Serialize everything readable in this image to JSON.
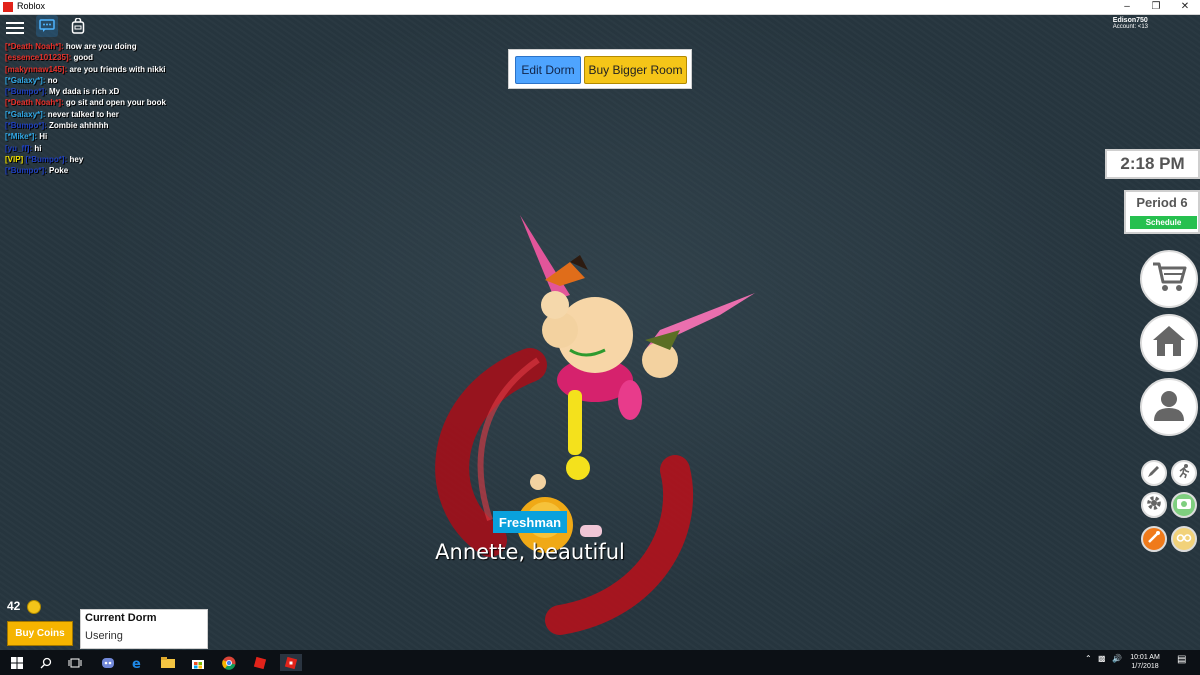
{
  "window": {
    "title": "Roblox"
  },
  "topbar": {
    "user_name": "Edison750",
    "account": "Account: <13"
  },
  "chat": [
    {
      "name": "[*Death Noah*]:",
      "color": "#e8312b",
      "msg": "how are you doing"
    },
    {
      "name": "[essence101235]:",
      "color": "#e8312b",
      "msg": "good"
    },
    {
      "name": "[makynnaw145]:",
      "color": "#e8312b",
      "msg": "are you friends with nikki"
    },
    {
      "name": "[*Galaxy*]:",
      "color": "#31a8e6",
      "msg": "no"
    },
    {
      "name": "[*Bumpo*]:",
      "color": "#1e3fbf",
      "msg": "My dada is rich xD"
    },
    {
      "name": "[*Death Noah*]:",
      "color": "#e8312b",
      "msg": "go sit and open your book"
    },
    {
      "name": "[*Galaxy*]:",
      "color": "#31a8e6",
      "msg": "never talked to her"
    },
    {
      "name": "[*Bumpo*]:",
      "color": "#1e3fbf",
      "msg": "Zombie ahhhhh"
    },
    {
      "name": "[*Mike*]:",
      "color": "#31a8e6",
      "msg": "Hi"
    },
    {
      "name": "[yu_ff]:",
      "color": "#1e3fbf",
      "msg": "hi"
    },
    {
      "vip": "[VIP]",
      "vip_color": "#f2e200",
      "name": "[*Bumpo*]:",
      "color": "#1e3fbf",
      "msg": "hey"
    },
    {
      "name": "[*Bumpo*]:",
      "color": "#1e3fbf",
      "msg": "Poke"
    }
  ],
  "dorm_buttons": {
    "edit": "Edit Dorm",
    "buy_bigger": "Buy Bigger Room"
  },
  "hud": {
    "time": "2:18 PM",
    "period": "Period 6",
    "schedule": "Schedule"
  },
  "character": {
    "grade_tag": "Freshman",
    "name_tag": "Annette, beautiful"
  },
  "bottom_left": {
    "coins": "42",
    "buy_coins": "Buy Coins",
    "dorm_title": "Current Dorm",
    "dorm_value": "Usering"
  },
  "taskbar": {
    "time": "10:01 AM",
    "date": "1/7/2018"
  },
  "icons": [
    "menu-icon",
    "chat-icon",
    "backpack-icon",
    "cart-icon",
    "home-icon",
    "avatar-icon",
    "pencil-icon",
    "running-icon",
    "gear-icon",
    "camera-icon",
    "emote-icon",
    "glasses-icon"
  ]
}
